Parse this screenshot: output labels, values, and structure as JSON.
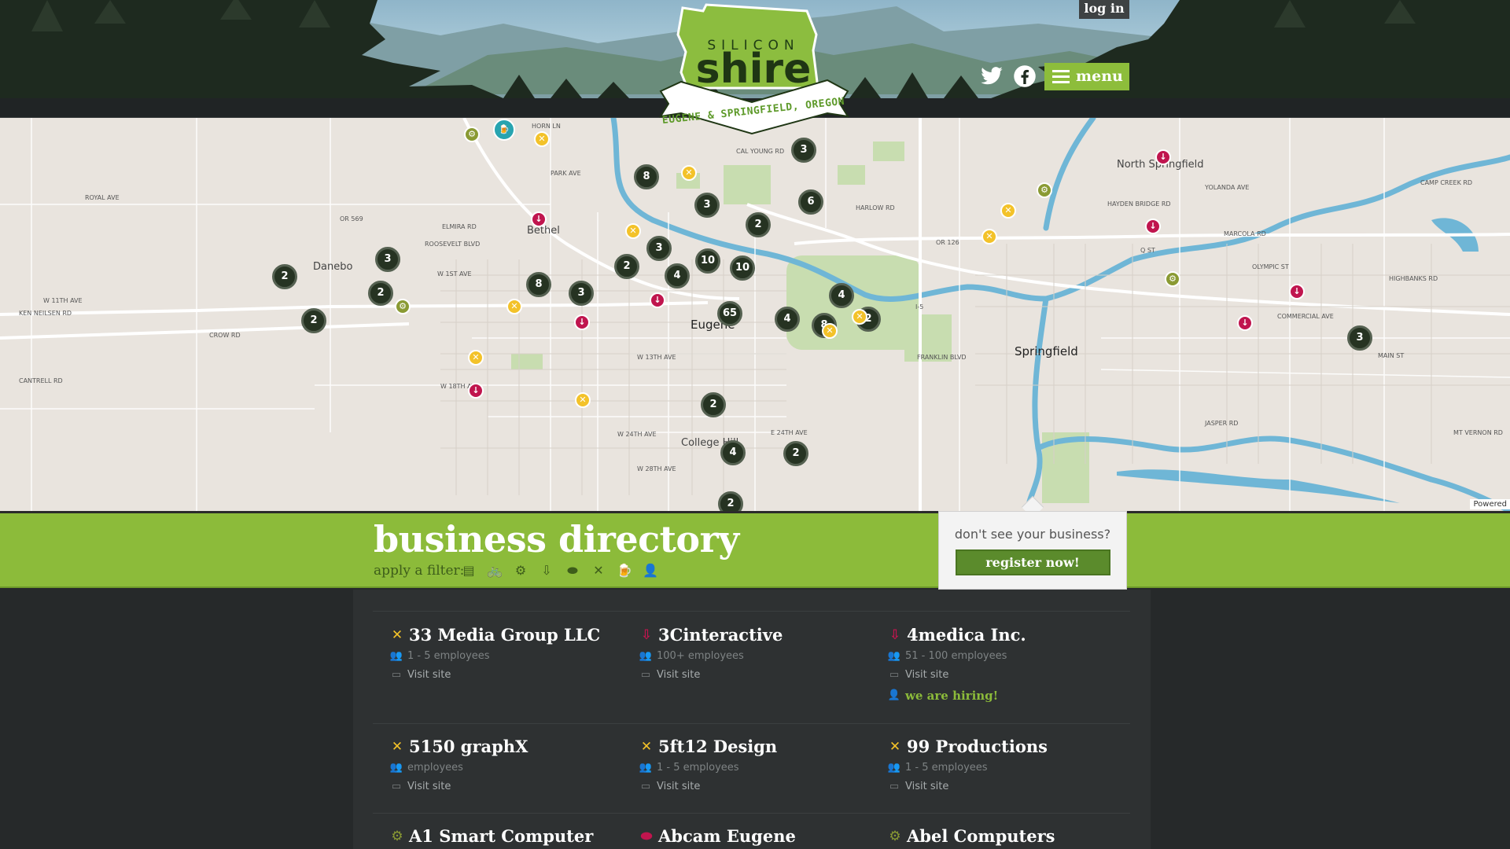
{
  "header": {
    "logo": {
      "top_text": "SILICON",
      "main_text": "shire",
      "ribbon_text": "EUGENE & SPRINGFIELD, OREGON"
    },
    "login_label": "log in",
    "menu_label": "menu",
    "social": [
      "twitter-icon",
      "facebook-icon"
    ]
  },
  "map": {
    "place_labels": [
      "North Springfield",
      "Bethel",
      "Danebo",
      "Eugene",
      "Springfield",
      "College Hill"
    ],
    "road_labels": [
      "ROYAL AVE",
      "W 11TH AVE",
      "CROW RD",
      "CANTRELL RD",
      "KEN NEILSEN RD",
      "W 18TH AVE",
      "W 24TH AVE",
      "W 28TH AVE",
      "OR 126",
      "HARLOW RD",
      "MAIN ST",
      "JASPER RD",
      "OR 569",
      "ELMIRA RD",
      "ROOSEVELT BLVD",
      "W 1ST AVE",
      "W 13TH AVE",
      "E 24TH AVE",
      "FRANKLIN BLVD",
      "Q ST",
      "MARCOLA RD",
      "HIGHBANKS RD",
      "MT VERNON RD",
      "CAMP CREEK RD",
      "YOLANDA AVE",
      "HAYDEN BRIDGE RD",
      "OLYMPIC ST",
      "COMMERCIAL AVE",
      "CAL YOUNG RD",
      "PARK AVE",
      "HORN LN",
      "I-5"
    ],
    "clusters": [
      "3",
      "8",
      "3",
      "6",
      "2",
      "3",
      "2",
      "3",
      "10",
      "10",
      "2",
      "2",
      "4",
      "2",
      "8",
      "3",
      "4",
      "65",
      "4",
      "8",
      "2",
      "2",
      "4",
      "2",
      "2",
      "3"
    ],
    "powered": "Powered"
  },
  "directory": {
    "title": "business directory",
    "filter_label": "apply a filter:",
    "filters": [
      "building-icon",
      "bicycle-icon",
      "gears-icon",
      "download-icon",
      "pill-icon",
      "tools-icon",
      "beer-icon",
      "user-plus-icon"
    ],
    "register_question": "don't see your business?",
    "register_label": "register now!",
    "businesses": [
      {
        "name": "33 Media Group LLC",
        "category": "tools",
        "employees": "1 - 5 employees",
        "visit": "Visit site"
      },
      {
        "name": "3Cinteractive",
        "category": "download",
        "employees": "100+ employees",
        "visit": "Visit site"
      },
      {
        "name": "4medica Inc.",
        "category": "download",
        "employees": "51 - 100 employees",
        "visit": "Visit site",
        "hiring": "we are hiring!"
      },
      {
        "name": "5150 graphX",
        "category": "tools",
        "employees": "employees",
        "visit": "Visit site"
      },
      {
        "name": "5ft12 Design",
        "category": "tools",
        "employees": "1 - 5 employees",
        "visit": "Visit site"
      },
      {
        "name": "99 Productions",
        "category": "tools",
        "employees": "1 - 5 employees",
        "visit": "Visit site"
      },
      {
        "name": "A1 Smart Computer",
        "category": "gears"
      },
      {
        "name": "Abcam Eugene",
        "category": "pill"
      },
      {
        "name": "Abel Computers",
        "category": "gears"
      }
    ]
  },
  "colors": {
    "brand_green": "#8cbb3a",
    "dark_bg": "#26292a",
    "cluster": "#263322",
    "pin_yellow": "#f3c229",
    "pin_red": "#c0154e",
    "pin_teal": "#27a4b0"
  }
}
